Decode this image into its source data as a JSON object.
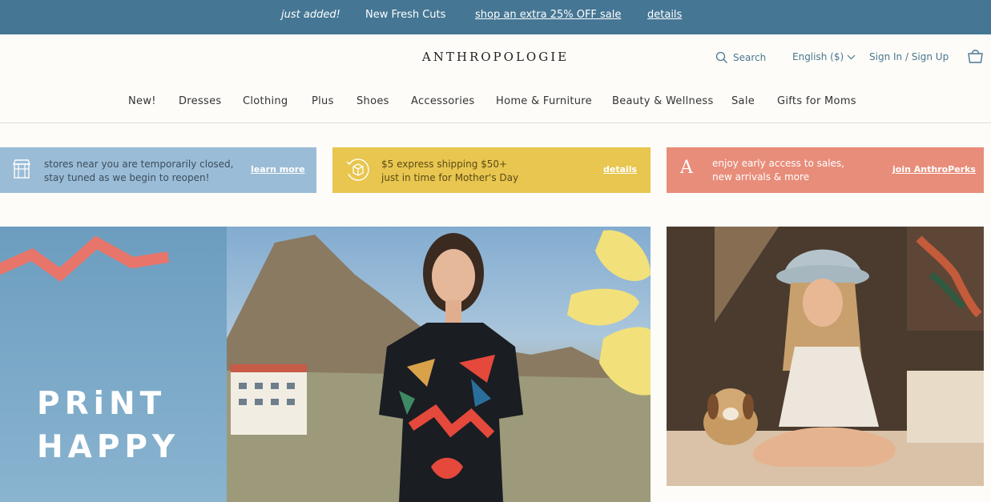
{
  "promo": {
    "just_added": "just added!",
    "fresh_cuts": "New Fresh Cuts",
    "sale_link": "shop an extra 25% OFF sale",
    "details_link": "details"
  },
  "header": {
    "logo": "ANTHROPOLOGIE",
    "search_label": "Search",
    "language_label": "English ($)",
    "sign_in_label": "Sign In / Sign Up"
  },
  "nav": {
    "items": [
      "New!",
      "Dresses",
      "Clothing",
      "Plus",
      "Shoes",
      "Accessories",
      "Home & Furniture",
      "Beauty & Wellness",
      "Sale",
      "Gifts for Moms"
    ]
  },
  "banners": [
    {
      "line1": "stores near you are temporarily closed,",
      "line2": "stay tuned as we begin to reopen!",
      "cta": "learn more",
      "icon": "storefront-icon"
    },
    {
      "line1": "$5 express shipping $50+",
      "line2": "just in time for Mother's Day",
      "cta": "details",
      "icon": "package-icon"
    },
    {
      "line1": "enjoy early access to sales,",
      "line2": "new arrivals & more",
      "cta": "join AnthroPerks",
      "icon": "anthroperks-a-icon",
      "icon_letter": "A"
    }
  ],
  "hero": {
    "line1": "PRiNT",
    "line2": "HAPPY"
  },
  "colors": {
    "promo_bg": "#457694",
    "accent_blue": "#4a7791",
    "banner_blue": "#9bbcd6",
    "banner_yellow": "#e8c64f",
    "banner_coral": "#e88d7a",
    "zigzag": "#e8756a",
    "leaf": "#f2e07a"
  }
}
